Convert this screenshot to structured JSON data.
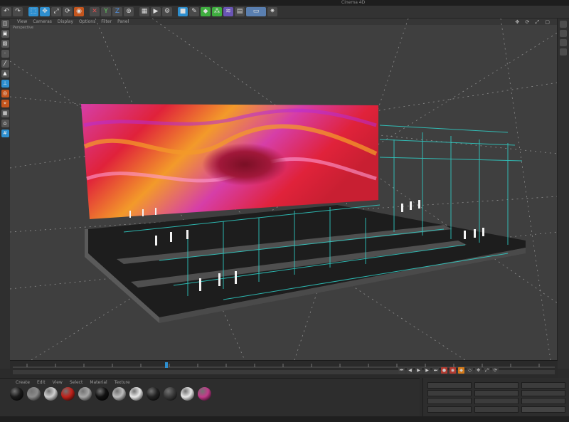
{
  "window": {
    "title": "Cinema 4D"
  },
  "toolbar": {
    "icons": [
      "undo-icon",
      "redo-icon",
      "select-icon",
      "move-icon",
      "scale-icon",
      "rotate-icon",
      "object-icon",
      "x-axis-icon",
      "y-axis-icon",
      "z-axis-icon",
      "world-icon",
      "render-view-icon",
      "render-icon",
      "render-settings-icon",
      "cube-icon",
      "pen-icon",
      "subdivision-icon",
      "cloner-icon",
      "deformer-icon",
      "scene-icon",
      "camera-icon",
      "light-icon"
    ]
  },
  "viewport": {
    "name": "Perspective",
    "menu": [
      "View",
      "Cameras",
      "Display",
      "Options",
      "Filter",
      "Panel"
    ],
    "scale_info": ""
  },
  "colors": {
    "accent": "#2e8fcf",
    "screen_red": "#e0223a",
    "screen_magenta": "#d63ea8",
    "screen_orange": "#f39a2a",
    "rig_cyan": "#2fd0c8",
    "floor": "#1d1d1d"
  },
  "materials": {
    "tabs": [
      "Create",
      "Edit",
      "View",
      "Select",
      "Material",
      "Texture"
    ],
    "items": [
      {
        "color": "#1a1a1a"
      },
      {
        "color": "#8b8b8b"
      },
      {
        "color": "#cfcfcf"
      },
      {
        "color": "#c0211a"
      },
      {
        "color": "#a6a6a6"
      },
      {
        "color": "#111111"
      },
      {
        "color": "#bdbdbd"
      },
      {
        "color": "#e9e9e9"
      },
      {
        "color": "#222222"
      },
      {
        "color": "#3a3a3a"
      },
      {
        "color": "#e8e8e8"
      },
      {
        "color": "#c23a8a"
      }
    ]
  },
  "attributes": {
    "apply_label": ""
  },
  "status": {
    "text": ""
  }
}
